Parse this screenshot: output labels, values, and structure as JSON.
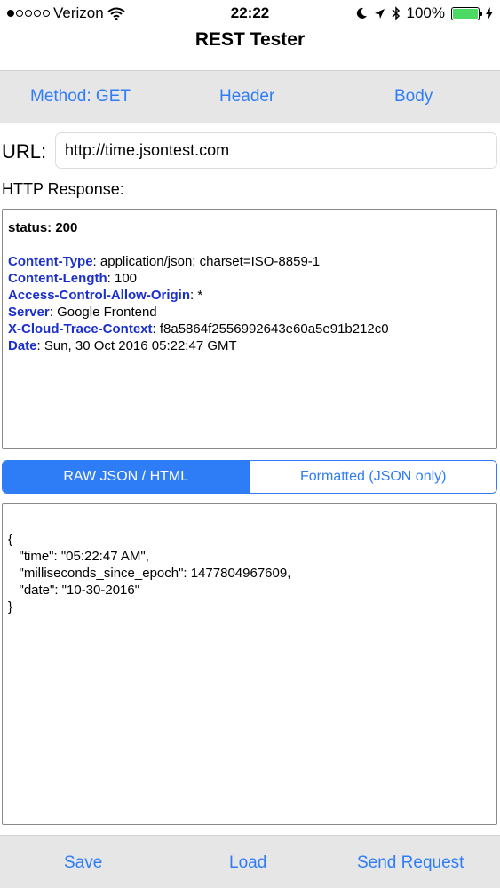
{
  "status_bar": {
    "carrier": "Verizon",
    "time": "22:22",
    "battery_percent": "100%",
    "battery_level": 1.0,
    "signal_bars_filled": 1,
    "signal_bars_total": 5
  },
  "nav": {
    "title": "REST Tester"
  },
  "toolbar": {
    "method_label": "Method: GET",
    "header_label": "Header",
    "body_label": "Body"
  },
  "url": {
    "label": "URL:",
    "value": "http://time.jsontest.com"
  },
  "response": {
    "label": "HTTP Response:",
    "status": "status: 200",
    "headers": [
      {
        "key": "Content-Type",
        "value": "application/json; charset=ISO-8859-1"
      },
      {
        "key": "Content-Length",
        "value": "100"
      },
      {
        "key": "Access-Control-Allow-Origin",
        "value": "*"
      },
      {
        "key": "Server",
        "value": "Google Frontend"
      },
      {
        "key": "X-Cloud-Trace-Context",
        "value": "f8a5864f2556992643e60a5e91b212c0"
      },
      {
        "key": "Date",
        "value": "Sun, 30 Oct 2016 05:22:47 GMT"
      }
    ]
  },
  "view_mode": {
    "raw_label": "RAW JSON / HTML",
    "formatted_label": "Formatted (JSON only)",
    "selected": "raw"
  },
  "body": {
    "lines": [
      "{",
      "   \"time\": \"05:22:47 AM\",",
      "   \"milliseconds_since_epoch\": 1477804967609,",
      "   \"date\": \"10-30-2016\"",
      "}"
    ]
  },
  "bottom_bar": {
    "save_label": "Save",
    "load_label": "Load",
    "send_label": "Send Request"
  },
  "colors": {
    "accent": "#2f7df6",
    "header_key": "#1a2fcc",
    "toolbar_bg": "#e6e6e6",
    "battery": "#4cd964"
  }
}
